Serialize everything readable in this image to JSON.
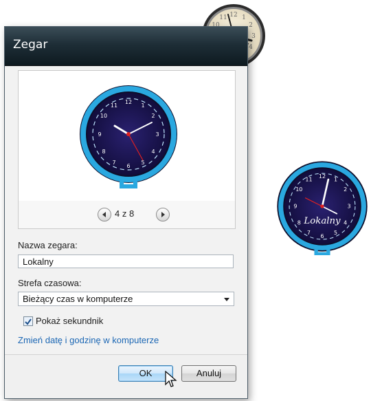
{
  "dialog": {
    "title": "Zegar",
    "pager": {
      "text": "4 z 8",
      "prev_icon": "arrow-left-icon",
      "next_icon": "arrow-right-icon"
    },
    "clock_name": {
      "label": "Nazwa zegara:",
      "value": "Lokalny"
    },
    "timezone": {
      "label": "Strefa czasowa:",
      "selected": "Bieżący czas w komputerze"
    },
    "show_seconds": {
      "label": "Pokaż sekundnik",
      "checked": true
    },
    "change_datetime_link": "Zmień datę i godzinę w komputerze",
    "ok_label": "OK",
    "cancel_label": "Anuluj"
  },
  "gadget_clock": {
    "name_label": "Lokalny"
  },
  "colors": {
    "accent": "#1c67b4",
    "clock_ring": "#2aa8e0",
    "clock_face": "#1a1452",
    "second_hand": "#e02020"
  }
}
